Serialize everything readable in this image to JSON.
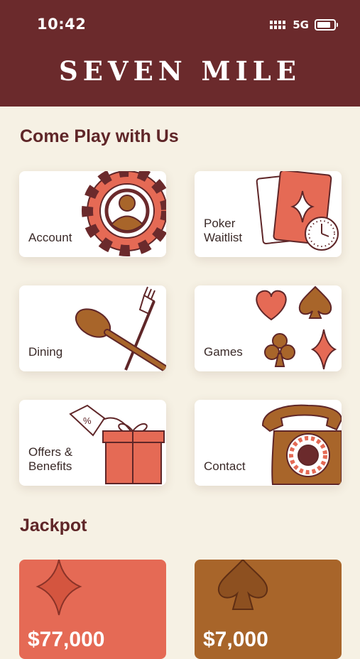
{
  "status": {
    "time": "10:42",
    "network": "5G"
  },
  "header": {
    "brand": "SEVEN MILE"
  },
  "sections": {
    "play_title": "Come Play with Us",
    "jackpot_title": "Jackpot"
  },
  "tiles": {
    "account": "Account",
    "poker": "Poker\nWaitlist",
    "dining": "Dining",
    "games": "Games",
    "offers": "Offers &\nBenefits",
    "contact": "Contact"
  },
  "jackpots": [
    {
      "amount": "$77,000",
      "color": "#e56a55"
    },
    {
      "amount": "$7,000",
      "color": "#a8652a"
    }
  ],
  "colors": {
    "header": "#6b2a2c",
    "background": "#f6f1e4",
    "coral": "#e56a55",
    "brown": "#a8652a",
    "ink": "#5f2628"
  }
}
